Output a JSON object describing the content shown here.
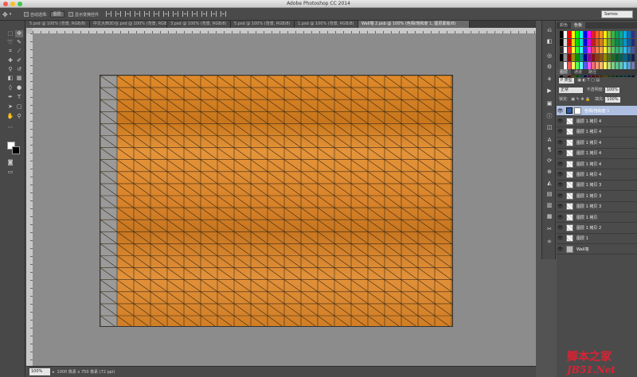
{
  "window": {
    "title": "Adobe Photoshop CC 2014"
  },
  "options_bar": {
    "auto_select_label": "自动选择:",
    "auto_select_value": "图层",
    "show_transform_label": "显示变换控件",
    "workspace": "Samos"
  },
  "tabs": [
    {
      "label": "5.psd @ 100% (背景, RGB/8)",
      "active": false
    },
    {
      "label": "中文大西3D合.psd @ 100% (背景, RGB/8#)",
      "active": false
    },
    {
      "label": "3.psd @ 100% (背景, RGB/8)",
      "active": false
    },
    {
      "label": "5.psd @ 100% (背景, RGB/8)",
      "active": false
    },
    {
      "label": "1.psd @ 100% (背景, RGB/8)",
      "active": false
    },
    {
      "label": "Wall墙 2.psb @ 100% (色相/饱和度 1, 图层蒙版/8)",
      "active": true
    }
  ],
  "status": {
    "zoom": "100%",
    "doc_size": "1000 像素 x 750 像素 (72 ppi)"
  },
  "panels": {
    "swatch_tabs": [
      "颜色",
      "色板"
    ],
    "layer_tabs": [
      "图层",
      "通道",
      "路径"
    ],
    "kind_label": "P 类型",
    "blend_mode": "正常",
    "opacity_label": "不透明度:",
    "opacity_value": "100%",
    "lock_label": "锁定:",
    "fill_label": "填充:",
    "fill_value": "100%"
  },
  "layers": [
    {
      "name": "色相/饱和度 1",
      "type": "adjustment",
      "selected": true
    },
    {
      "name": "图层 1 拷贝 4",
      "type": "orange",
      "selected": false
    },
    {
      "name": "图层 1 拷贝 4",
      "type": "orange",
      "selected": false
    },
    {
      "name": "图层 1 拷贝 4",
      "type": "orange",
      "selected": false
    },
    {
      "name": "图层 1 拷贝 4",
      "type": "orange",
      "selected": false
    },
    {
      "name": "图层 1 拷贝 4",
      "type": "orange",
      "selected": false
    },
    {
      "name": "图层 1 拷贝 4",
      "type": "orange",
      "selected": false
    },
    {
      "name": "图层 1 拷贝 3",
      "type": "orange",
      "selected": false
    },
    {
      "name": "图层 1 拷贝 3",
      "type": "orange",
      "selected": false
    },
    {
      "name": "图层 1 拷贝 3",
      "type": "orange",
      "selected": false
    },
    {
      "name": "图层 1 拷贝",
      "type": "orange",
      "selected": false
    },
    {
      "name": "图层 1 拷贝 2",
      "type": "orange",
      "selected": false
    },
    {
      "name": "图层 1",
      "type": "orange",
      "selected": false
    },
    {
      "name": "Wall墙",
      "type": "grey",
      "selected": false
    }
  ],
  "swatch_colors": [
    "#000000",
    "#ffffff",
    "#ff0000",
    "#ffff00",
    "#00ff00",
    "#00ffff",
    "#0000ff",
    "#ff00ff",
    "#ee1d24",
    "#f26522",
    "#f7941d",
    "#fff200",
    "#8dc63f",
    "#39b54a",
    "#00a651",
    "#00a99d",
    "#00aeef",
    "#0072bc",
    "#2e3192"
  ],
  "watermark": {
    "cn": "脚本之家",
    "site": "JB51.Net"
  }
}
